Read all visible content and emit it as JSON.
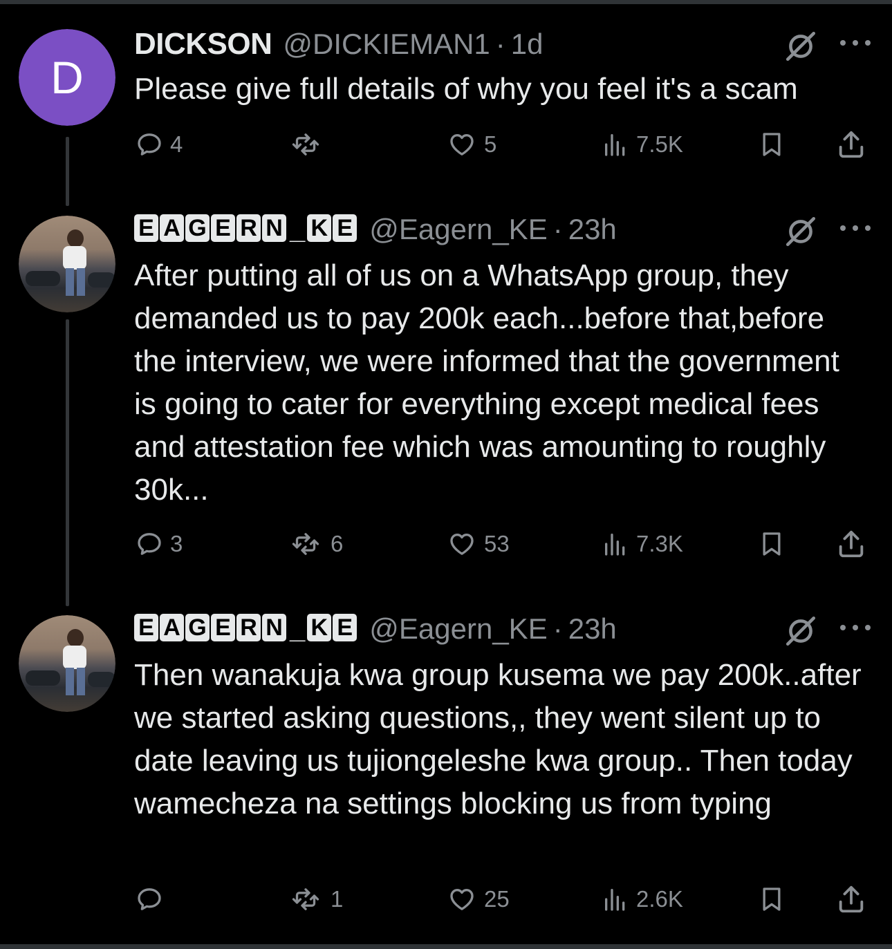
{
  "tweets": [
    {
      "avatar_letter": "D",
      "name": "DICKSON",
      "handle": "@DICKIEMAN1",
      "separator": "·",
      "time": "1d",
      "text": "Please give full details of why you feel it's a scam",
      "replies": "4",
      "reposts": "",
      "likes": "5",
      "views": "7.5K"
    },
    {
      "name_letters": [
        "E",
        "A",
        "G",
        "E",
        "R",
        "N",
        "K",
        "E"
      ],
      "name": "EAGERN_KE",
      "handle": "@Eagern_KE",
      "separator": "·",
      "time": "23h",
      "text": "After putting all of us on a WhatsApp group, they demanded us to pay 200k each...before that,before the interview, we were informed that the government is going to cater for everything except medical fees and attestation fee which was amounting to roughly 30k...",
      "replies": "3",
      "reposts": "6",
      "likes": "53",
      "views": "7.3K"
    },
    {
      "name_letters": [
        "E",
        "A",
        "G",
        "E",
        "R",
        "N",
        "K",
        "E"
      ],
      "name": "EAGERN_KE",
      "handle": "@Eagern_KE",
      "separator": "·",
      "time": "23h",
      "text": "Then wanakuja kwa group kusema we pay 200k..after we started asking questions,, they went silent up to date leaving us tujiongeleshe kwa group.. Then today wamecheza na settings blocking us from typing",
      "replies": "",
      "reposts": "1",
      "likes": "25",
      "views": "2.6K"
    }
  ],
  "colors": {
    "background": "#000000",
    "text": "#e7e9ea",
    "muted": "#8b8f94",
    "avatar_purple": "#7b4fc4",
    "thread_line": "#333639"
  },
  "icons": [
    "reply-icon",
    "repost-icon",
    "like-icon",
    "views-icon",
    "bookmark-icon",
    "share-icon",
    "grok-icon",
    "more-icon"
  ]
}
